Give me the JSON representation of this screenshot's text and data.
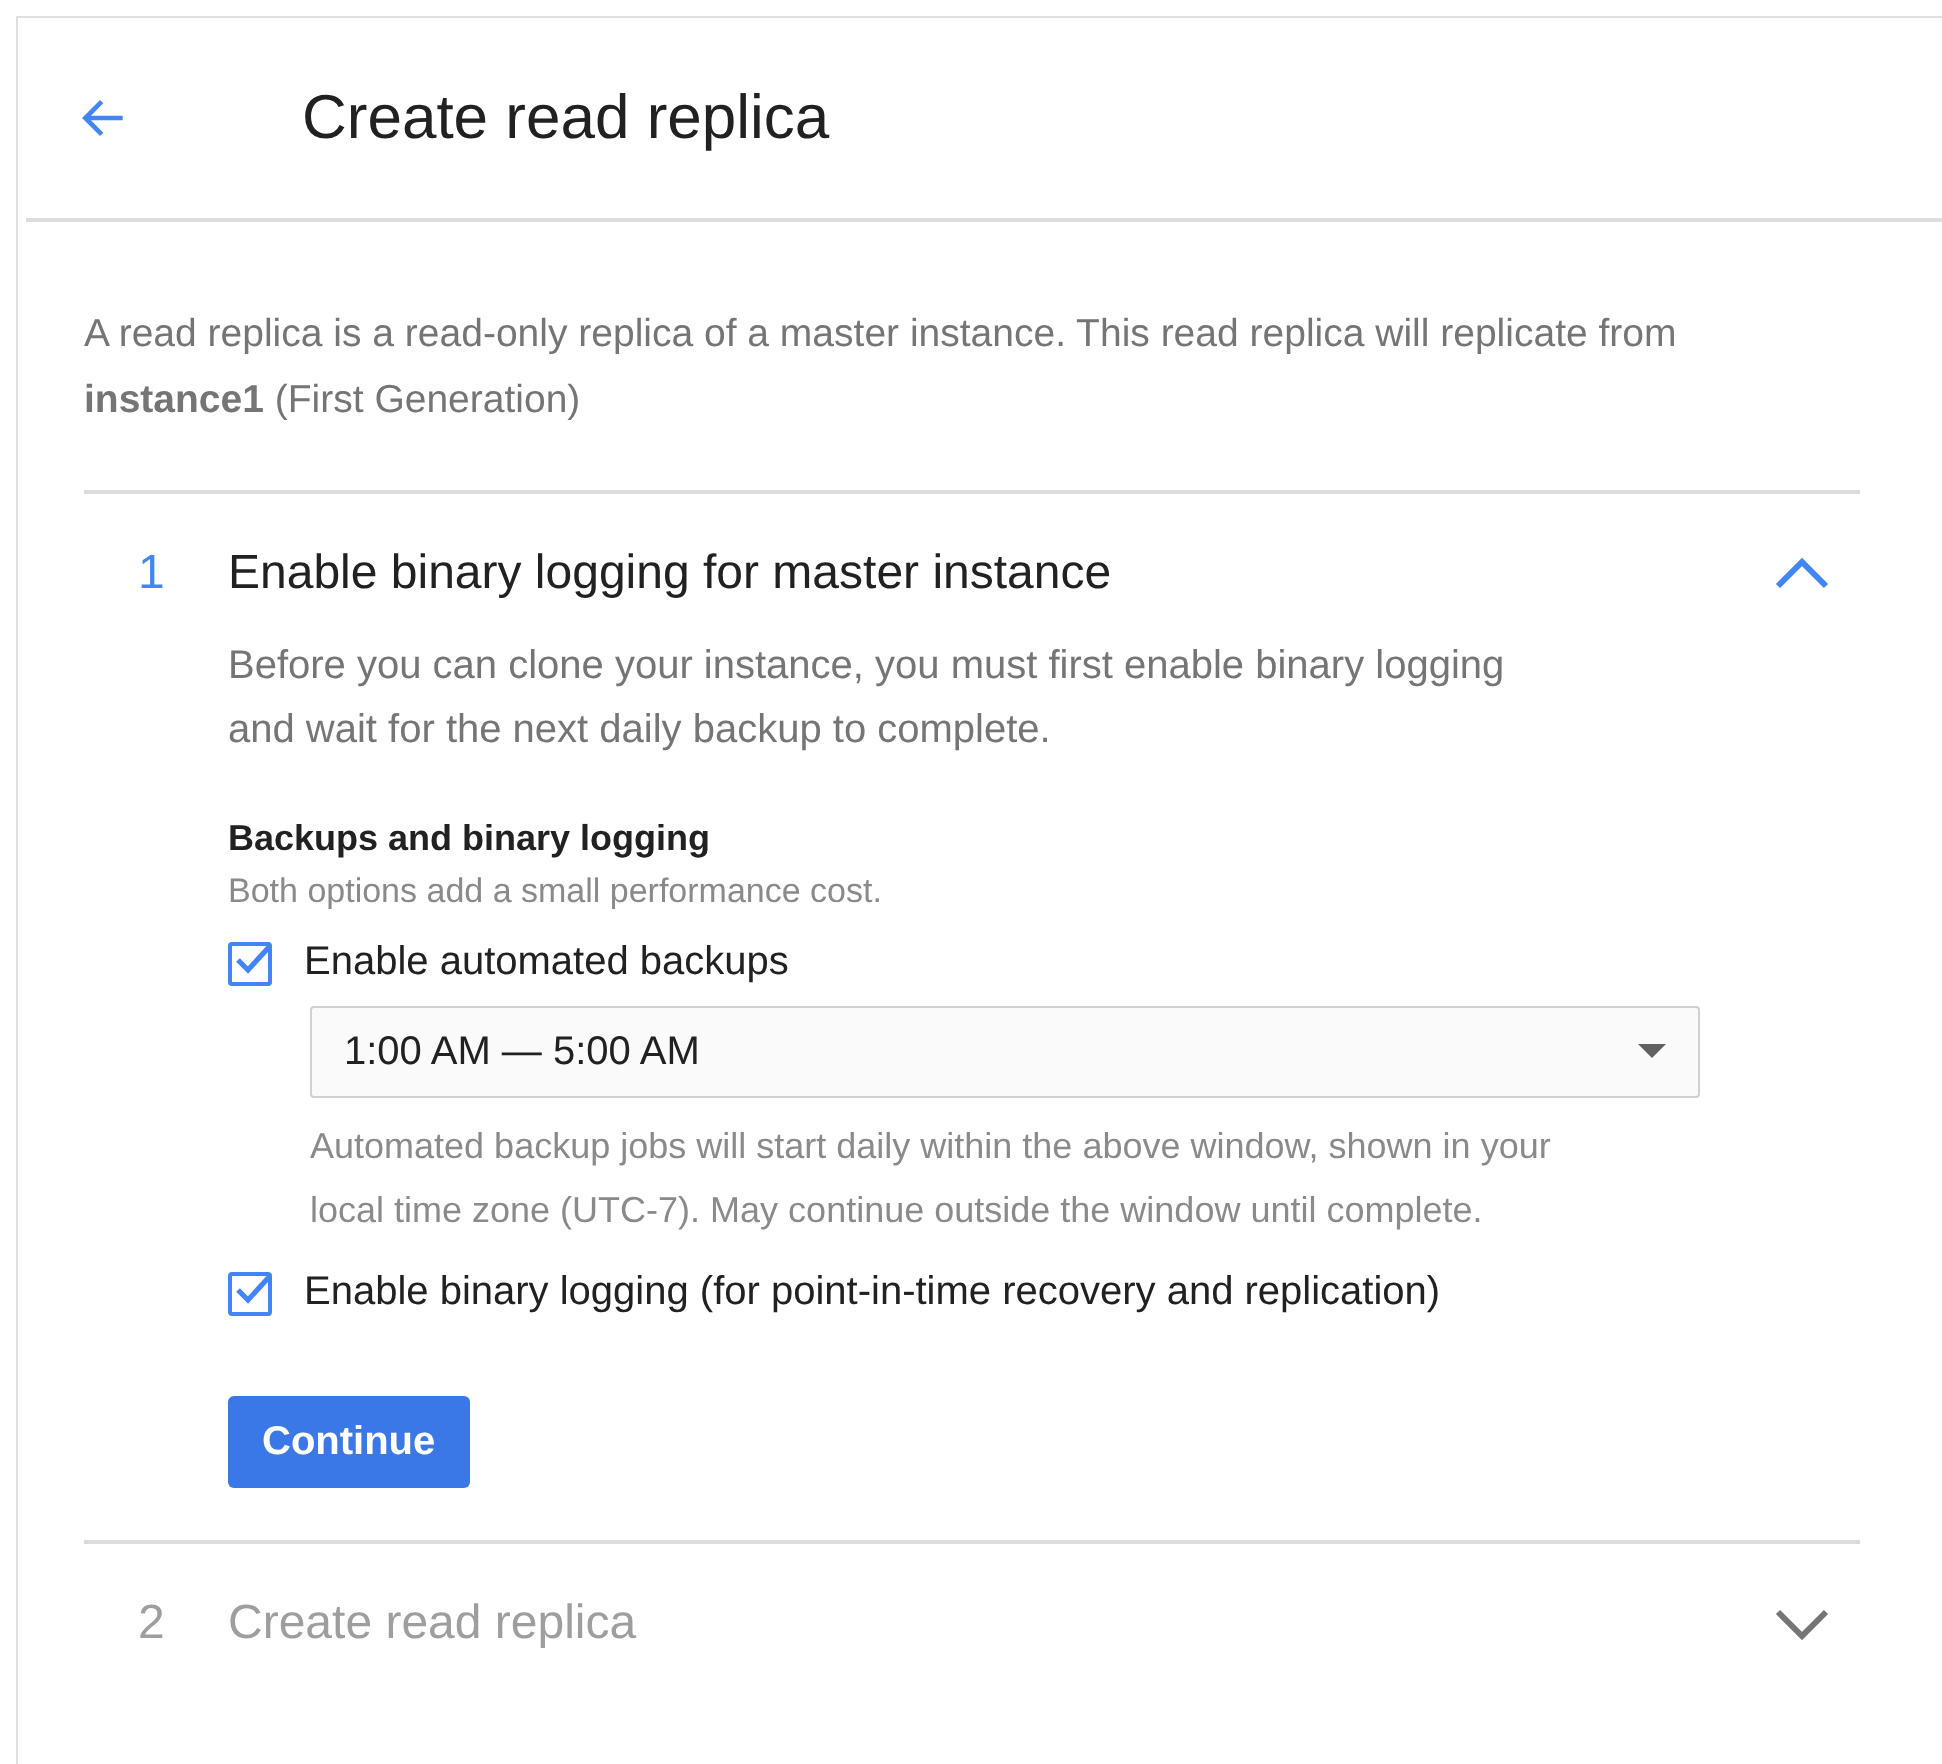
{
  "header": {
    "title": "Create read replica"
  },
  "intro": "A read replica is a read-only replica of a master instance. This read replica will replicate from **instance1** (First Generation)",
  "steps": [
    {
      "number": "1",
      "title": "Enable binary logging for master instance",
      "expanded": true,
      "disabled": false,
      "description": "Before you can clone your instance, you must first enable binary logging and wait for the next daily backup to complete.",
      "section_title": "Backups and binary logging",
      "section_subtitle": "Both options add a small performance cost.",
      "options": [
        {
          "kind": "checkbox",
          "label": "Enable automated backups",
          "checked": true
        },
        {
          "kind": "select",
          "value": "1:00 AM — 5:00 AM",
          "help": "Automated backup jobs will start daily within the above window, shown in your local time zone (UTC-7). May continue outside the window until complete."
        },
        {
          "kind": "checkbox",
          "label": "Enable binary logging (for point-in-time recovery and replication)",
          "checked": true
        }
      ],
      "button": "Continue"
    },
    {
      "number": "2",
      "title": "Create read replica",
      "expanded": false,
      "disabled": true
    }
  ]
}
